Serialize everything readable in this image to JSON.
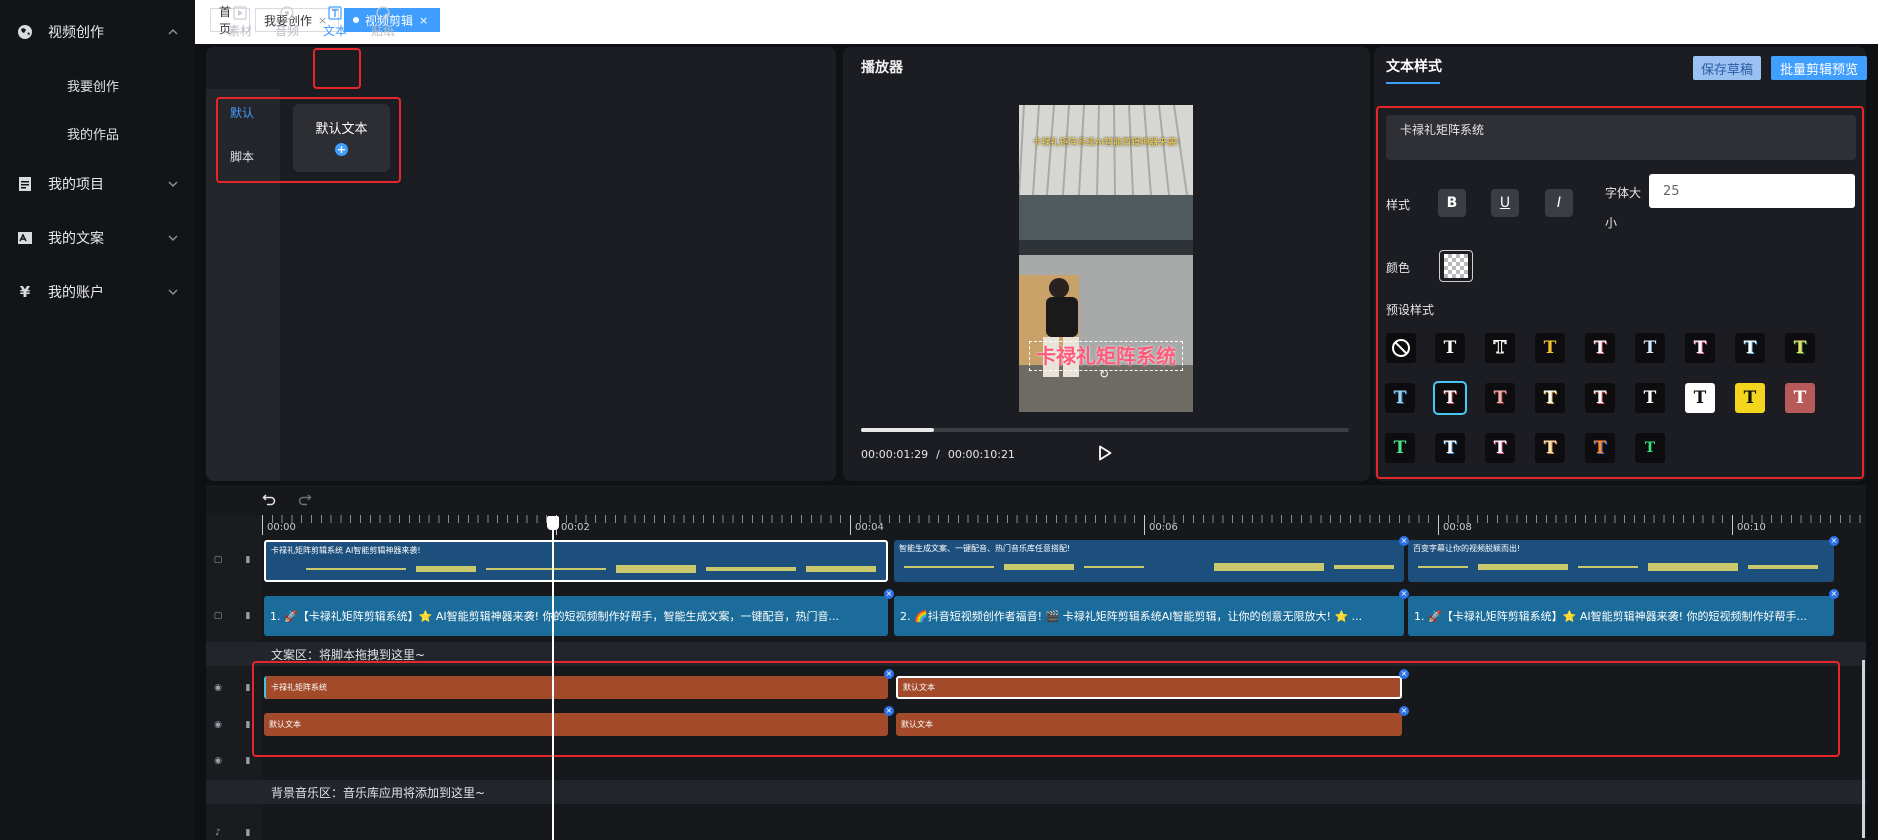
{
  "sidebar": {
    "items": [
      {
        "label": "视频创作",
        "icon": "globe-icon"
      },
      {
        "label": "我要创作"
      },
      {
        "label": "我的作品"
      },
      {
        "label": "我的项目",
        "icon": "document-icon"
      },
      {
        "label": "我的文案",
        "icon": "edit-icon"
      },
      {
        "label": "我的账户",
        "icon": "yen-icon"
      }
    ]
  },
  "tabs": [
    {
      "label": "首页"
    },
    {
      "label": "我要创作",
      "close": "×"
    },
    {
      "label": "视频剪辑",
      "close": "×"
    }
  ],
  "library": {
    "tabs": [
      "素材",
      "音频",
      "文本",
      "贴纸"
    ],
    "categories": [
      "默认",
      "脚本"
    ],
    "card": {
      "title": "默认文本",
      "add": "+"
    }
  },
  "player": {
    "title": "播放器",
    "overlay_top": "卡禄礼矩阵系统AI智能剪辑神器来袭!",
    "overlay_text": "卡禄礼矩阵系统",
    "current": "00:00:01:29",
    "sep": "/",
    "total": "00:00:10:21",
    "progress": 0.15
  },
  "textstyle": {
    "title": "文本样式",
    "save_label": "保存草稿",
    "preview_label": "批量剪辑预览",
    "text_value": "卡禄礼矩阵系统",
    "style_label": "样式",
    "bold": "B",
    "underline": "U",
    "italic": "I",
    "fontsize_label": "字体大小",
    "fontsize_value": "25",
    "color_label": "颜色",
    "preset_label": "预设样式"
  },
  "timeline": {
    "ruler": [
      "00:00",
      "00:02",
      "00:04",
      "00:06",
      "00:08",
      "00:10"
    ],
    "video_clips": [
      {
        "caption": "卡禄礼矩阵剪辑系统 AI智能剪辑神器来袭!"
      },
      {
        "caption": "智能生成文案、一键配音、热门音乐库任意搭配!"
      },
      {
        "caption": "百变字幕让你的视频脱颖而出!"
      }
    ],
    "text_clips": [
      {
        "text": "1. 🚀【卡禄礼矩阵剪辑系统】⭐ AI智能剪辑神器来袭! 你的短视频制作好帮手，智能生成文案，一键配音，热门音..."
      },
      {
        "text": "2. 🌈抖音短视频创作者福音! 🎬 卡禄礼矩阵剪辑系统AI智能剪辑，让你的创意无限放大! ⭐ ..."
      },
      {
        "text": "1. 🚀【卡禄礼矩阵剪辑系统】⭐ AI智能剪辑神器来袭! 你的短视频制作好帮手..."
      }
    ],
    "script_zone": "文案区：将脚本拖拽到这里~",
    "subtitle_rows": [
      [
        "卡禄礼矩阵系统",
        "默认文本"
      ],
      [
        "默认文本",
        "默认文本"
      ]
    ],
    "music_zone": "背景音乐区：音乐库应用将添加到这里~"
  },
  "colors": {
    "accent": "#409eff",
    "highlight": "#e7262b",
    "clip_orange": "#a24a2a",
    "clip_blue": "#1b6c9a"
  }
}
